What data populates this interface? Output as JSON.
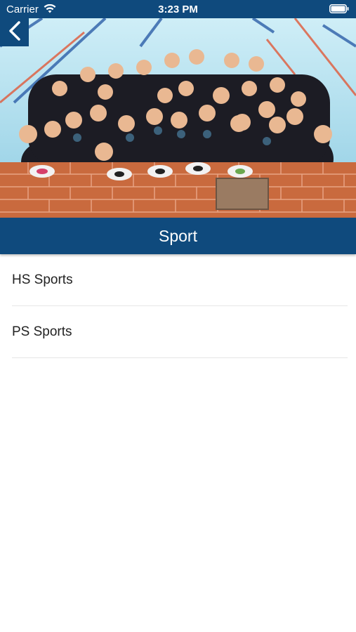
{
  "status_bar": {
    "carrier": "Carrier",
    "time": "3:23 PM"
  },
  "header": {
    "back_icon": "chevron-left-icon",
    "title": "Sport"
  },
  "hero_image": {
    "subject": "team photo"
  },
  "list": {
    "items": [
      {
        "label": "HS Sports"
      },
      {
        "label": "PS Sports"
      }
    ]
  },
  "colors": {
    "brand": "#0f4a7d",
    "background": "#ffffff",
    "text": "#222222",
    "divider": "#e6e6e6"
  }
}
